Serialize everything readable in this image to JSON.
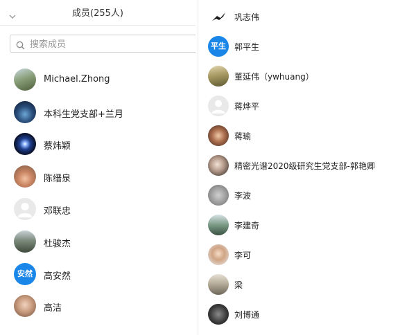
{
  "header": {
    "title": "成员(255人)"
  },
  "search": {
    "placeholder": "搜索成员",
    "value": ""
  },
  "left_members": [
    {
      "name": "Michael.Zhong",
      "avatar": "photo"
    },
    {
      "name": "本科生党支部+兰月",
      "avatar": "photo"
    },
    {
      "name": "蔡炜颖",
      "avatar": "photo"
    },
    {
      "name": "陈缙泉",
      "avatar": "photo"
    },
    {
      "name": "邓联忠",
      "avatar": "default"
    },
    {
      "name": "杜骏杰",
      "avatar": "photo"
    },
    {
      "name": "高安然",
      "avatar": "text",
      "avatar_text": "安然"
    },
    {
      "name": "高洁",
      "avatar": "photo"
    }
  ],
  "right_members": [
    {
      "name": "巩志伟",
      "avatar": "photo"
    },
    {
      "name": "郭平生",
      "avatar": "text",
      "avatar_text": "平生"
    },
    {
      "name": "董延伟（ywhuang）",
      "avatar": "photo"
    },
    {
      "name": "蒋烨平",
      "avatar": "default"
    },
    {
      "name": "蒋瑜",
      "avatar": "photo"
    },
    {
      "name": "精密光谱2020级研究生党支部-郭艳卿",
      "avatar": "photo"
    },
    {
      "name": "李波",
      "avatar": "photo"
    },
    {
      "name": "李建奇",
      "avatar": "photo"
    },
    {
      "name": "李可",
      "avatar": "photo"
    },
    {
      "name": "梁",
      "avatar": "photo"
    },
    {
      "name": "刘博通",
      "avatar": "photo"
    }
  ],
  "colors": {
    "accent": "#1a86e8",
    "divider": "#e6e6e6"
  }
}
